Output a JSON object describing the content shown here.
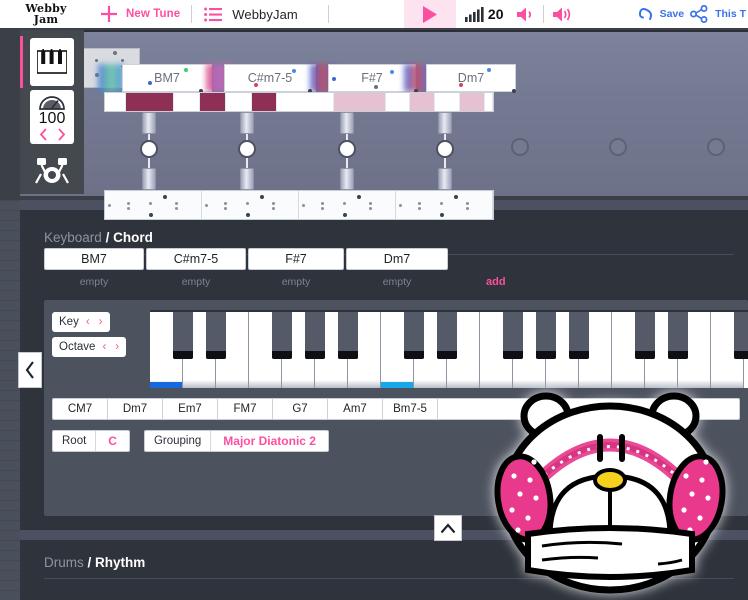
{
  "toolbar": {
    "logo_line1": "Webby",
    "logo_line2": "Jam",
    "new_tune_label": "New Tune",
    "tune_name": "WebbyJam",
    "tempo_value": "20",
    "save_label": "Save",
    "share_label": "This T",
    "accent_pink": "#fd4fa0",
    "link_blue": "#3b72e8"
  },
  "track": {
    "bpm": "100",
    "chord_labels": [
      "BM7",
      "C#m7-5",
      "F#7",
      "Dm7"
    ]
  },
  "keyboard_section": {
    "title_muted": "Keyboard",
    "title_sep": "/",
    "title_strong": "Chord",
    "chord_slots": [
      "BM7",
      "C#m7-5",
      "F#7",
      "Dm7"
    ],
    "slot_states": [
      "empty",
      "empty",
      "empty",
      "empty"
    ],
    "add_label": "add",
    "key_label": "Key",
    "octave_label": "Octave",
    "chord_buttons": [
      "CM7",
      "Dm7",
      "Em7",
      "FM7",
      "G7",
      "Am7",
      "Bm7-5"
    ],
    "root_label": "Root",
    "root_value": "C",
    "grouping_label": "Grouping",
    "grouping_value": "Major Diatonic 2"
  },
  "drums_section": {
    "title_muted": "Drums",
    "title_sep": "/",
    "title_strong": "Rhythm"
  },
  "icons": {
    "plus": "plus-icon",
    "list": "list-icon",
    "play": "play-icon",
    "signal": "signal-icon",
    "volume": "volume-icon",
    "volume_alt": "volume-alt-icon",
    "undo": "undo-icon",
    "share": "share-icon",
    "piano": "piano-icon",
    "gauge": "tempo-gauge-icon",
    "drumkit": "drumkit-icon",
    "chevron_left": "chevron-left-icon",
    "chevron_right": "chevron-right-icon",
    "chevron_up": "chevron-up-icon",
    "mascot": "bear-mascot-icon"
  }
}
